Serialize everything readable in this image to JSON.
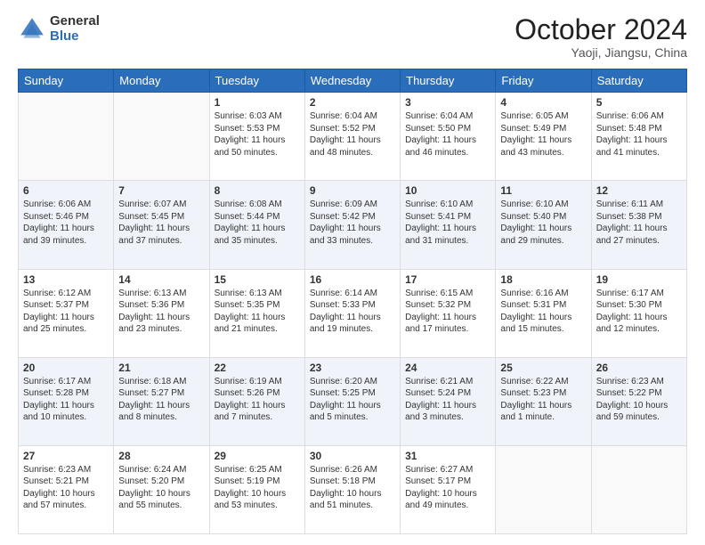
{
  "header": {
    "logo": {
      "general": "General",
      "blue": "Blue"
    },
    "title": "October 2024",
    "location": "Yaoji, Jiangsu, China"
  },
  "weekdays": [
    "Sunday",
    "Monday",
    "Tuesday",
    "Wednesday",
    "Thursday",
    "Friday",
    "Saturday"
  ],
  "weeks": [
    [
      {
        "day": "",
        "sunrise": "",
        "sunset": "",
        "daylight": ""
      },
      {
        "day": "",
        "sunrise": "",
        "sunset": "",
        "daylight": ""
      },
      {
        "day": "1",
        "sunrise": "Sunrise: 6:03 AM",
        "sunset": "Sunset: 5:53 PM",
        "daylight": "Daylight: 11 hours and 50 minutes."
      },
      {
        "day": "2",
        "sunrise": "Sunrise: 6:04 AM",
        "sunset": "Sunset: 5:52 PM",
        "daylight": "Daylight: 11 hours and 48 minutes."
      },
      {
        "day": "3",
        "sunrise": "Sunrise: 6:04 AM",
        "sunset": "Sunset: 5:50 PM",
        "daylight": "Daylight: 11 hours and 46 minutes."
      },
      {
        "day": "4",
        "sunrise": "Sunrise: 6:05 AM",
        "sunset": "Sunset: 5:49 PM",
        "daylight": "Daylight: 11 hours and 43 minutes."
      },
      {
        "day": "5",
        "sunrise": "Sunrise: 6:06 AM",
        "sunset": "Sunset: 5:48 PM",
        "daylight": "Daylight: 11 hours and 41 minutes."
      }
    ],
    [
      {
        "day": "6",
        "sunrise": "Sunrise: 6:06 AM",
        "sunset": "Sunset: 5:46 PM",
        "daylight": "Daylight: 11 hours and 39 minutes."
      },
      {
        "day": "7",
        "sunrise": "Sunrise: 6:07 AM",
        "sunset": "Sunset: 5:45 PM",
        "daylight": "Daylight: 11 hours and 37 minutes."
      },
      {
        "day": "8",
        "sunrise": "Sunrise: 6:08 AM",
        "sunset": "Sunset: 5:44 PM",
        "daylight": "Daylight: 11 hours and 35 minutes."
      },
      {
        "day": "9",
        "sunrise": "Sunrise: 6:09 AM",
        "sunset": "Sunset: 5:42 PM",
        "daylight": "Daylight: 11 hours and 33 minutes."
      },
      {
        "day": "10",
        "sunrise": "Sunrise: 6:10 AM",
        "sunset": "Sunset: 5:41 PM",
        "daylight": "Daylight: 11 hours and 31 minutes."
      },
      {
        "day": "11",
        "sunrise": "Sunrise: 6:10 AM",
        "sunset": "Sunset: 5:40 PM",
        "daylight": "Daylight: 11 hours and 29 minutes."
      },
      {
        "day": "12",
        "sunrise": "Sunrise: 6:11 AM",
        "sunset": "Sunset: 5:38 PM",
        "daylight": "Daylight: 11 hours and 27 minutes."
      }
    ],
    [
      {
        "day": "13",
        "sunrise": "Sunrise: 6:12 AM",
        "sunset": "Sunset: 5:37 PM",
        "daylight": "Daylight: 11 hours and 25 minutes."
      },
      {
        "day": "14",
        "sunrise": "Sunrise: 6:13 AM",
        "sunset": "Sunset: 5:36 PM",
        "daylight": "Daylight: 11 hours and 23 minutes."
      },
      {
        "day": "15",
        "sunrise": "Sunrise: 6:13 AM",
        "sunset": "Sunset: 5:35 PM",
        "daylight": "Daylight: 11 hours and 21 minutes."
      },
      {
        "day": "16",
        "sunrise": "Sunrise: 6:14 AM",
        "sunset": "Sunset: 5:33 PM",
        "daylight": "Daylight: 11 hours and 19 minutes."
      },
      {
        "day": "17",
        "sunrise": "Sunrise: 6:15 AM",
        "sunset": "Sunset: 5:32 PM",
        "daylight": "Daylight: 11 hours and 17 minutes."
      },
      {
        "day": "18",
        "sunrise": "Sunrise: 6:16 AM",
        "sunset": "Sunset: 5:31 PM",
        "daylight": "Daylight: 11 hours and 15 minutes."
      },
      {
        "day": "19",
        "sunrise": "Sunrise: 6:17 AM",
        "sunset": "Sunset: 5:30 PM",
        "daylight": "Daylight: 11 hours and 12 minutes."
      }
    ],
    [
      {
        "day": "20",
        "sunrise": "Sunrise: 6:17 AM",
        "sunset": "Sunset: 5:28 PM",
        "daylight": "Daylight: 11 hours and 10 minutes."
      },
      {
        "day": "21",
        "sunrise": "Sunrise: 6:18 AM",
        "sunset": "Sunset: 5:27 PM",
        "daylight": "Daylight: 11 hours and 8 minutes."
      },
      {
        "day": "22",
        "sunrise": "Sunrise: 6:19 AM",
        "sunset": "Sunset: 5:26 PM",
        "daylight": "Daylight: 11 hours and 7 minutes."
      },
      {
        "day": "23",
        "sunrise": "Sunrise: 6:20 AM",
        "sunset": "Sunset: 5:25 PM",
        "daylight": "Daylight: 11 hours and 5 minutes."
      },
      {
        "day": "24",
        "sunrise": "Sunrise: 6:21 AM",
        "sunset": "Sunset: 5:24 PM",
        "daylight": "Daylight: 11 hours and 3 minutes."
      },
      {
        "day": "25",
        "sunrise": "Sunrise: 6:22 AM",
        "sunset": "Sunset: 5:23 PM",
        "daylight": "Daylight: 11 hours and 1 minute."
      },
      {
        "day": "26",
        "sunrise": "Sunrise: 6:23 AM",
        "sunset": "Sunset: 5:22 PM",
        "daylight": "Daylight: 10 hours and 59 minutes."
      }
    ],
    [
      {
        "day": "27",
        "sunrise": "Sunrise: 6:23 AM",
        "sunset": "Sunset: 5:21 PM",
        "daylight": "Daylight: 10 hours and 57 minutes."
      },
      {
        "day": "28",
        "sunrise": "Sunrise: 6:24 AM",
        "sunset": "Sunset: 5:20 PM",
        "daylight": "Daylight: 10 hours and 55 minutes."
      },
      {
        "day": "29",
        "sunrise": "Sunrise: 6:25 AM",
        "sunset": "Sunset: 5:19 PM",
        "daylight": "Daylight: 10 hours and 53 minutes."
      },
      {
        "day": "30",
        "sunrise": "Sunrise: 6:26 AM",
        "sunset": "Sunset: 5:18 PM",
        "daylight": "Daylight: 10 hours and 51 minutes."
      },
      {
        "day": "31",
        "sunrise": "Sunrise: 6:27 AM",
        "sunset": "Sunset: 5:17 PM",
        "daylight": "Daylight: 10 hours and 49 minutes."
      },
      {
        "day": "",
        "sunrise": "",
        "sunset": "",
        "daylight": ""
      },
      {
        "day": "",
        "sunrise": "",
        "sunset": "",
        "daylight": ""
      }
    ]
  ]
}
